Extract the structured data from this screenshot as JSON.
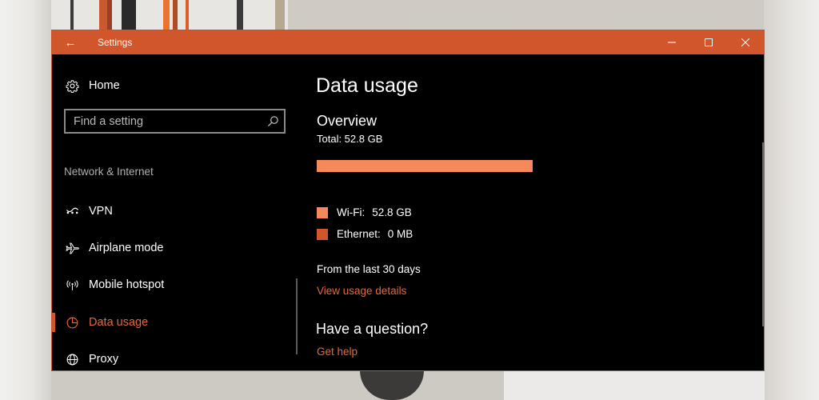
{
  "window": {
    "title": "Settings",
    "back_glyph": "←",
    "titlebar_color": "#d2562b",
    "controls": [
      "minimize-icon",
      "maximize-icon",
      "close-icon"
    ]
  },
  "sidebar": {
    "home_label": "Home",
    "home_icon": "gear-icon",
    "search_placeholder": "Find a setting",
    "search_icon": "search-icon",
    "section_label": "Network & Internet",
    "items": [
      {
        "label": "VPN",
        "icon": "vpn-icon",
        "selected": false
      },
      {
        "label": "Airplane mode",
        "icon": "airplane-icon",
        "selected": false
      },
      {
        "label": "Mobile hotspot",
        "icon": "hotspot-icon",
        "selected": false
      },
      {
        "label": "Data usage",
        "icon": "pie-chart-icon",
        "selected": true
      },
      {
        "label": "Proxy",
        "icon": "globe-icon",
        "selected": false
      }
    ]
  },
  "main": {
    "title": "Data usage",
    "overview_title": "Overview",
    "total": "Total: 52.8 GB",
    "wifi_fraction": 1.0,
    "legend": [
      {
        "label": "Wi-Fi:",
        "value": "52.8 GB",
        "color": "#f6895b"
      },
      {
        "label": "Ethernet:",
        "value": "0 MB",
        "color": "#d2562b"
      }
    ],
    "period": "From the last 30 days",
    "view_details_link": "View usage details",
    "question": "Have a question?",
    "help_link": "Get help"
  },
  "colors": {
    "accent": "#d2562b",
    "link": "#e6673d",
    "background": "#000000",
    "wifi": "#f6895b"
  }
}
